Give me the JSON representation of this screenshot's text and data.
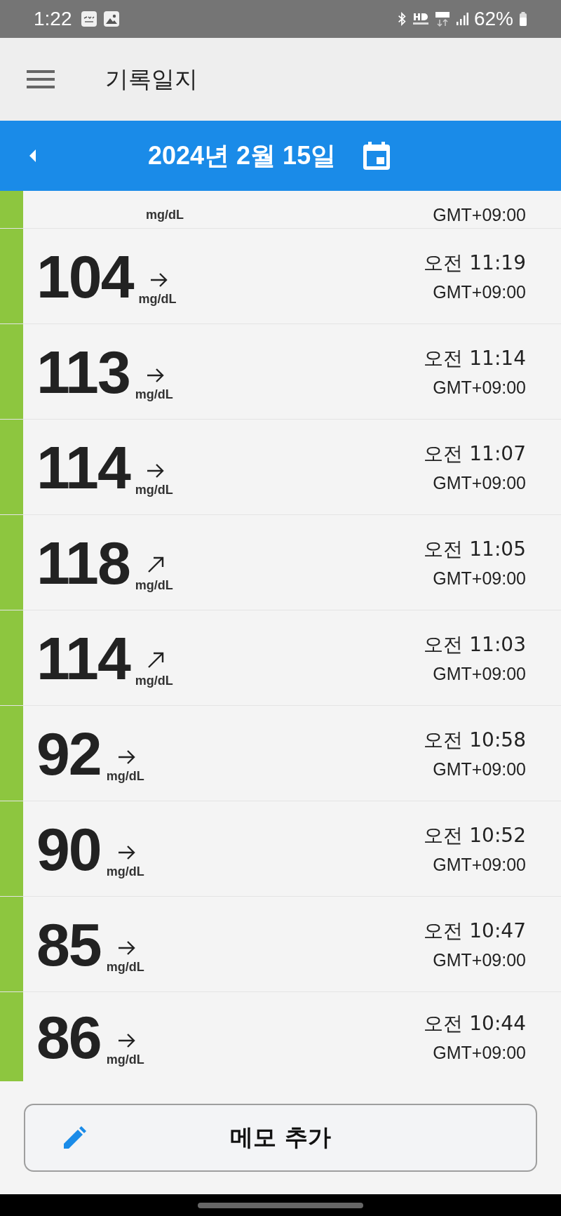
{
  "status_bar": {
    "time": "1:22",
    "battery": "62%"
  },
  "app_bar": {
    "title": "기록일지"
  },
  "date_bar": {
    "date": "2024년 2월 15일"
  },
  "readings": [
    {
      "kind": "partial",
      "unit": "mg/dL",
      "timezone": "GMT+09:00",
      "color": "#8dc63f"
    },
    {
      "kind": "full",
      "value": "104",
      "arrow": {
        "kind": "right"
      },
      "unit": "mg/dL",
      "time": "오전 11:19",
      "timezone": "GMT+09:00",
      "color": "#8dc63f"
    },
    {
      "kind": "full",
      "value": "113",
      "arrow": {
        "kind": "right"
      },
      "unit": "mg/dL",
      "time": "오전 11:14",
      "timezone": "GMT+09:00",
      "color": "#8dc63f"
    },
    {
      "kind": "full",
      "value": "114",
      "arrow": {
        "kind": "right"
      },
      "unit": "mg/dL",
      "time": "오전 11:07",
      "timezone": "GMT+09:00",
      "color": "#8dc63f"
    },
    {
      "kind": "full",
      "value": "118",
      "arrow": {
        "kind": "diagonal"
      },
      "unit": "mg/dL",
      "time": "오전 11:05",
      "timezone": "GMT+09:00",
      "color": "#8dc63f"
    },
    {
      "kind": "full",
      "value": "114",
      "arrow": {
        "kind": "diagonal"
      },
      "unit": "mg/dL",
      "time": "오전 11:03",
      "timezone": "GMT+09:00",
      "color": "#8dc63f"
    },
    {
      "kind": "full",
      "value": "92",
      "arrow": {
        "kind": "right"
      },
      "unit": "mg/dL",
      "time": "오전 10:58",
      "timezone": "GMT+09:00",
      "color": "#8dc63f"
    },
    {
      "kind": "full",
      "value": "90",
      "arrow": {
        "kind": "right"
      },
      "unit": "mg/dL",
      "time": "오전 10:52",
      "timezone": "GMT+09:00",
      "color": "#8dc63f"
    },
    {
      "kind": "full",
      "value": "85",
      "arrow": {
        "kind": "right"
      },
      "unit": "mg/dL",
      "time": "오전 10:47",
      "timezone": "GMT+09:00",
      "color": "#8dc63f"
    },
    {
      "kind": "full",
      "value": "86",
      "arrow": {
        "kind": "right"
      },
      "unit": "mg/dL",
      "time": "오전 10:44",
      "timezone": "GMT+09:00",
      "color": "#8dc63f"
    }
  ],
  "memo_button": {
    "label": "메모 추가"
  }
}
